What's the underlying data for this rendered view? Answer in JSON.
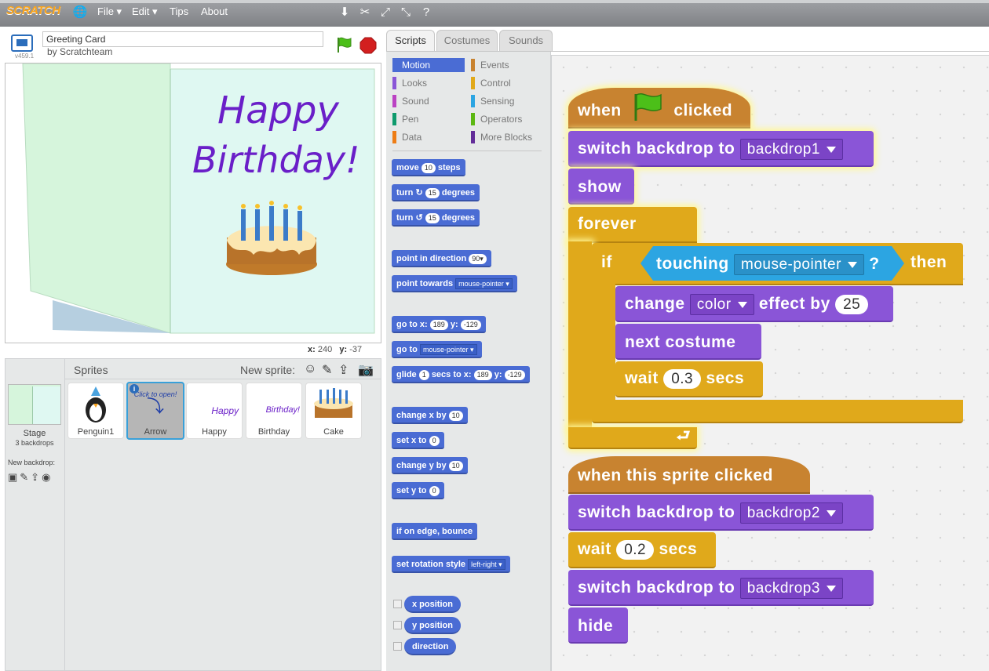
{
  "menubar": {
    "logo": "SCRATCH",
    "items": [
      "File ▾",
      "Edit ▾",
      "Tips",
      "About"
    ]
  },
  "project": {
    "title": "Greeting Card",
    "author": "by Scratchteam",
    "version": "v459.1"
  },
  "stage": {
    "card_text_line1": "Happy",
    "card_text_line2": "Birthday!",
    "coords_x_label": "x:",
    "coords_x": "240",
    "coords_y_label": "y:",
    "coords_y": "-37"
  },
  "sprites": {
    "title": "Sprites",
    "new_sprite_label": "New sprite:",
    "stage_label": "Stage",
    "stage_backdrops": "3 backdrops",
    "new_backdrop_label": "New backdrop:",
    "items": [
      "Penguin1",
      "Arrow",
      "Happy",
      "Birthday",
      "Cake"
    ],
    "arrow_thumb_text": "Click to open!",
    "happy_thumb_text": "Happy",
    "birthday_thumb_text": "Birthday!"
  },
  "tabs": [
    "Scripts",
    "Costumes",
    "Sounds"
  ],
  "categories": {
    "left": [
      "Motion",
      "Looks",
      "Sound",
      "Pen",
      "Data"
    ],
    "right": [
      "Events",
      "Control",
      "Sensing",
      "Operators",
      "More Blocks"
    ],
    "colors_left": [
      "#4a6cd4",
      "#8a55d7",
      "#bb42c3",
      "#0e9a6c",
      "#ee7d16"
    ],
    "colors_right": [
      "#c88330",
      "#e1a91a",
      "#2ca5e2",
      "#5cb712",
      "#632d99"
    ]
  },
  "palette": {
    "move": [
      "move",
      "10",
      "steps"
    ],
    "turn_r": [
      "turn",
      "↻",
      "15",
      "degrees"
    ],
    "turn_l": [
      "turn",
      "↺",
      "15",
      "degrees"
    ],
    "point_dir": [
      "point in direction",
      "90▾"
    ],
    "point_towards": [
      "point towards",
      "mouse-pointer ▾"
    ],
    "goto_xy": [
      "go to x:",
      "189",
      "y:",
      "-129"
    ],
    "goto": [
      "go to",
      "mouse-pointer ▾"
    ],
    "glide": [
      "glide",
      "1",
      "secs to x:",
      "189",
      "y:",
      "-129"
    ],
    "change_x": [
      "change x by",
      "10"
    ],
    "set_x": [
      "set x to",
      "0"
    ],
    "change_y": [
      "change y by",
      "10"
    ],
    "set_y": [
      "set y to",
      "0"
    ],
    "bounce": "if on edge, bounce",
    "rot_style": [
      "set rotation style",
      "left-right ▾"
    ],
    "reporters": [
      "x position",
      "y position",
      "direction"
    ]
  },
  "script1": {
    "hat": [
      "when",
      "clicked"
    ],
    "switch1": [
      "switch backdrop to",
      "backdrop1"
    ],
    "show": "show",
    "forever": "forever",
    "if": [
      "if",
      "touching",
      "mouse-pointer",
      "?",
      "then"
    ],
    "change": [
      "change",
      "color",
      "effect by",
      "25"
    ],
    "next": "next costume",
    "wait": [
      "wait",
      "0.3",
      "secs"
    ]
  },
  "script2": {
    "hat": "when this sprite clicked",
    "switch2": [
      "switch backdrop to",
      "backdrop2"
    ],
    "wait": [
      "wait",
      "0.2",
      "secs"
    ],
    "switch3": [
      "switch backdrop to",
      "backdrop3"
    ],
    "hide": "hide"
  }
}
